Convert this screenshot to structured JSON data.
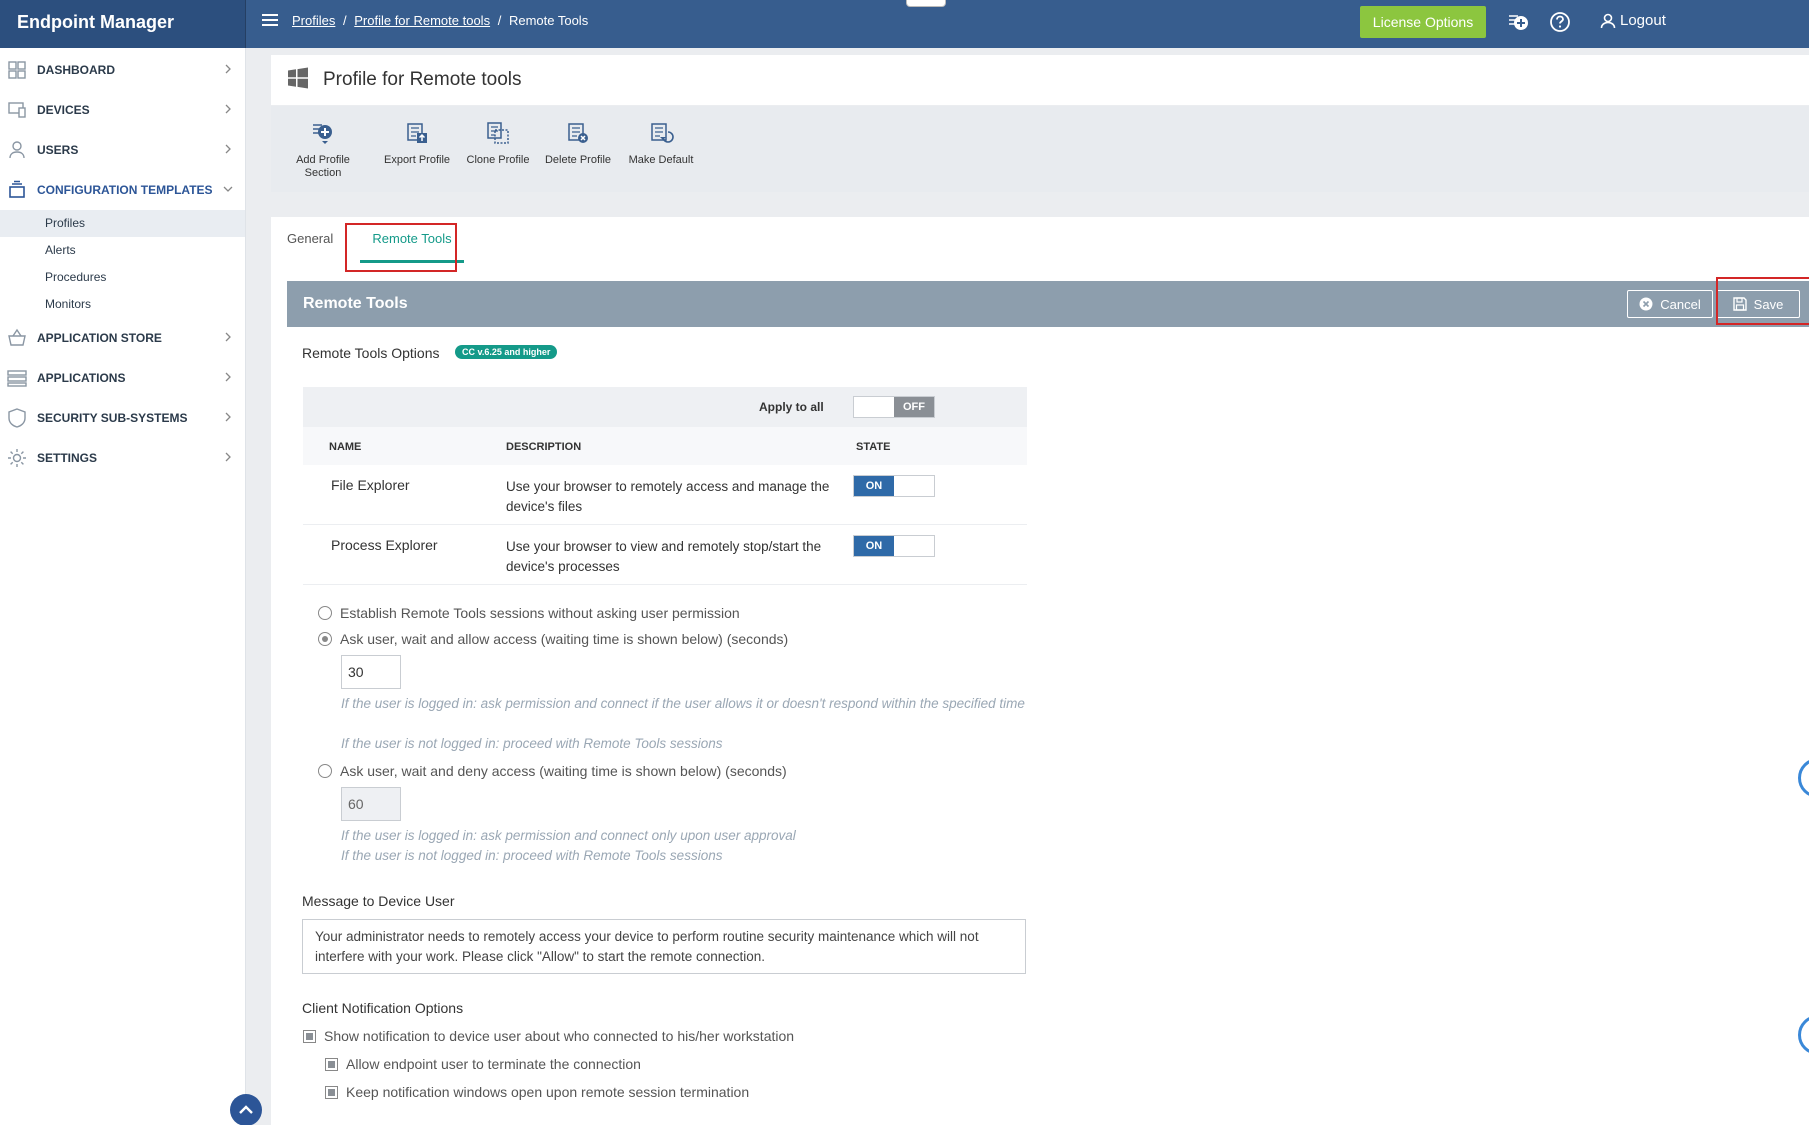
{
  "app": {
    "title": "Endpoint Manager"
  },
  "breadcrumb": {
    "profiles": "Profiles",
    "profile": "Profile for Remote tools",
    "current": "Remote Tools",
    "sep": "/"
  },
  "topbar": {
    "license_label": "License Options",
    "logout_label": "Logout"
  },
  "sidebar": {
    "items": [
      {
        "label": "DASHBOARD"
      },
      {
        "label": "DEVICES"
      },
      {
        "label": "USERS"
      },
      {
        "label": "CONFIGURATION TEMPLATES"
      },
      {
        "label": "APPLICATION STORE"
      },
      {
        "label": "APPLICATIONS"
      },
      {
        "label": "SECURITY SUB-SYSTEMS"
      },
      {
        "label": "SETTINGS"
      }
    ],
    "sub_items": [
      {
        "label": "Profiles"
      },
      {
        "label": "Alerts"
      },
      {
        "label": "Procedures"
      },
      {
        "label": "Monitors"
      }
    ]
  },
  "page": {
    "title": "Profile for Remote tools"
  },
  "toolbar": {
    "add_line1": "Add Profile",
    "add_line2": "Section",
    "export": "Export Profile",
    "clone": "Clone Profile",
    "delete": "Delete Profile",
    "default": "Make Default"
  },
  "tabs": {
    "general": "General",
    "remote": "Remote Tools"
  },
  "panel": {
    "title": "Remote Tools",
    "cancel": "Cancel",
    "save": "Save"
  },
  "options": {
    "label": "Remote Tools Options",
    "badge": "CC v.6.25 and higher",
    "apply_all": "Apply to all",
    "apply_state": "OFF",
    "col_name": "NAME",
    "col_desc": "DESCRIPTION",
    "col_state": "STATE",
    "rows": [
      {
        "name": "File Explorer",
        "desc": "Use your browser to remotely access and manage the device's files",
        "state": "ON"
      },
      {
        "name": "Process Explorer",
        "desc": "Use your browser to view and remotely stop/start the device's processes",
        "state": "ON"
      }
    ]
  },
  "permissions": {
    "opt1": "Establish Remote Tools sessions without asking user permission",
    "opt2": "Ask user, wait and allow access (waiting time is shown below)  (seconds)",
    "opt2_value": "30",
    "opt2_hint1": "If the user is logged in: ask permission and connect if the user allows it or doesn't respond within the specified time",
    "opt2_hint2": "If the user is not logged in: proceed with Remote Tools sessions",
    "opt3": "Ask user, wait and deny access (waiting time is shown below)  (seconds)",
    "opt3_value": "60",
    "opt3_hint1": "If the user is logged in: ask permission and connect only upon user approval",
    "opt3_hint2": "If the user is not logged in: proceed with Remote Tools sessions"
  },
  "message": {
    "label": "Message to Device User",
    "text": "Your administrator needs to remotely access your device to perform routine security maintenance which will not interfere with your work. Please click \"Allow\" to start the remote connection."
  },
  "notifications": {
    "label": "Client Notification Options",
    "opt1": "Show notification to device user about who connected to his/her workstation",
    "opt2": "Allow endpoint user to terminate the connection",
    "opt3": "Keep notification windows open upon remote session termination"
  },
  "colors": {
    "topbar": "#375d8e",
    "accent": "#149a89",
    "highlight": "#d32626",
    "license": "#8cc63f"
  }
}
